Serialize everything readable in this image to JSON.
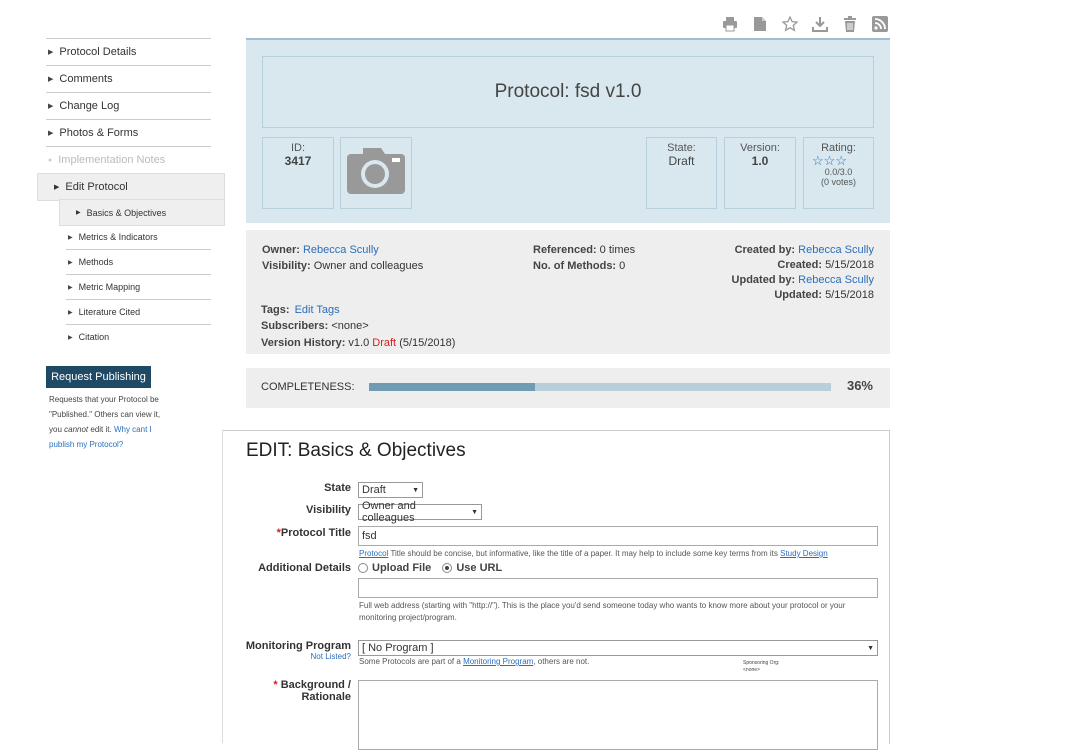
{
  "toolbar": {
    "icons": [
      "print-icon",
      "document-icon",
      "star-icon",
      "download-icon",
      "trash-icon",
      "rss-icon"
    ]
  },
  "sidebar": {
    "items": [
      {
        "label": "Protocol Details"
      },
      {
        "label": "Comments"
      },
      {
        "label": "Change Log"
      },
      {
        "label": "Photos & Forms"
      },
      {
        "label": "Implementation Notes"
      }
    ],
    "edit_label": "Edit Protocol",
    "sub_items": [
      {
        "label": "Basics & Objectives"
      },
      {
        "label": "Metrics & Indicators"
      },
      {
        "label": "Methods"
      },
      {
        "label": "Metric Mapping"
      },
      {
        "label": "Literature Cited"
      },
      {
        "label": "Citation"
      }
    ],
    "request_button": "Request Publishing",
    "request_text_1": "Requests that your Protocol be \"Published.\" Others can view it, you ",
    "request_text_em": "cannot",
    "request_text_2": " edit it. ",
    "request_link": "Why cant I publish my Protocol?"
  },
  "header": {
    "title": "Protocol: fsd v1.0",
    "id_label": "ID:",
    "id_value": "3417",
    "state_label": "State:",
    "state_value": "Draft",
    "version_label": "Version:",
    "version_value": "1.0",
    "rating_label": "Rating:",
    "rating_stars": "☆☆☆",
    "rating_score": "0.0/3.0",
    "rating_votes": "(0 votes)"
  },
  "meta": {
    "owner_label": "Owner:",
    "owner_value": "Rebecca Scully",
    "visibility_label": "Visibility:",
    "visibility_value": "Owner and colleagues",
    "referenced_label": "Referenced:",
    "referenced_value": "0 times",
    "methods_label": "No. of Methods:",
    "methods_value": "0",
    "created_by_label": "Created by:",
    "created_by_value": "Rebecca Scully",
    "created_label": "Created:",
    "created_value": "5/15/2018",
    "updated_by_label": "Updated by:",
    "updated_by_value": "Rebecca Scully",
    "updated_label": "Updated:",
    "updated_value": "5/15/2018",
    "tags_label": "Tags:",
    "tags_link": "Edit Tags",
    "subscribers_label": "Subscribers:",
    "subscribers_value": "<none>",
    "version_history_label": "Version History:",
    "version_history_value": "v1.0",
    "version_history_state": "Draft",
    "version_history_date": "(5/15/2018)"
  },
  "completeness": {
    "label": "COMPLETENESS:",
    "percent_text": "36%",
    "fraction": 0.36
  },
  "edit": {
    "title": "EDIT: Basics & Objectives",
    "state_label": "State",
    "state_value": "Draft",
    "visibility_label": "Visibility",
    "visibility_value": "Owner and colleagues",
    "title_label": "Protocol Title",
    "title_value": "fsd",
    "title_help_link1": "Protocol",
    "title_help_mid": " Title should be concise, but informative, like the title of a paper. It may help to include some key terms from its ",
    "title_help_link2": "Study Design",
    "details_label": "Additional Details",
    "upload_label": "Upload File",
    "url_label": "Use URL",
    "url_value": "",
    "url_help": "Full web address (starting with \"http://\"). This is the place you'd send someone today who wants to know more about your protocol or your monitoring project/program.",
    "program_label": "Monitoring Program",
    "not_listed": "Not Listed?",
    "program_value": "[ No Program ]",
    "program_help_1": "Some Protocols are part of a ",
    "program_help_link": "Monitoring Program",
    "program_help_2": ", others are not.",
    "sponsoring_label": "Sponsoring Org:",
    "sponsoring_value": "<none>",
    "background_label": "Background / Rationale",
    "background_value": ""
  }
}
